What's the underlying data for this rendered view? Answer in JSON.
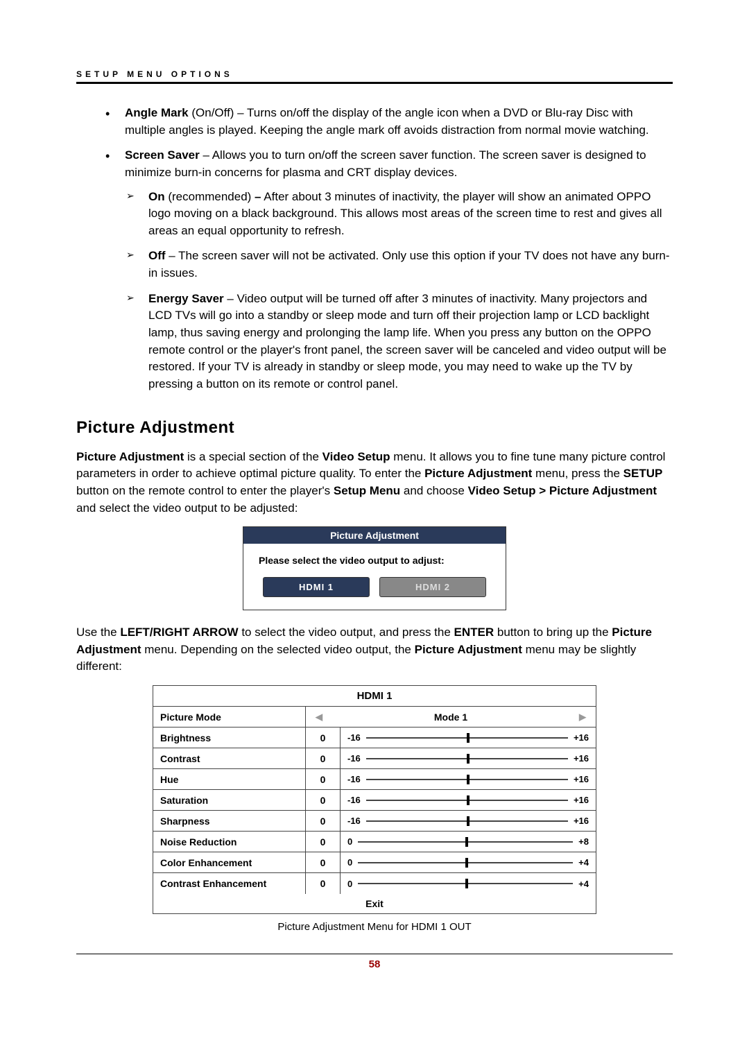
{
  "header": {
    "section": "SETUP MENU OPTIONS"
  },
  "list": {
    "item1": {
      "bold": "Angle Mark",
      "tail": " (On/Off) – Turns on/off the display of the angle icon when a DVD or Blu-ray Disc with multiple angles is played. Keeping the angle mark off avoids distraction from normal movie watching."
    },
    "item2": {
      "bold": "Screen Saver",
      "tail": " – Allows you to turn on/off the screen saver function. The screen saver is designed to minimize burn-in concerns for plasma and CRT display devices.",
      "sub1": {
        "bold": "On",
        "after_bold": " (recommended) ",
        "bold2": "–",
        "tail": " After about 3 minutes of inactivity, the player will show an animated OPPO logo moving on a black background. This allows most areas of the screen time to rest and gives all areas an equal opportunity to refresh."
      },
      "sub2": {
        "bold": "Off",
        "tail": " – The screen saver will not be activated. Only use this option if your TV does not have any burn-in issues."
      },
      "sub3": {
        "bold": "Energy Saver",
        "tail": " – Video output will be turned off after 3 minutes of inactivity. Many projectors and LCD TVs will go into a standby or sleep mode and turn off their projection lamp or LCD backlight lamp, thus saving energy and prolonging the lamp life.  When you press any button on the OPPO remote control or the player's front panel, the screen saver will be canceled and video output will be restored. If your TV is already in standby or sleep mode, you may need to wake up the TV by pressing a button on its remote or control panel."
      }
    }
  },
  "heading": "Picture Adjustment",
  "para1": {
    "p1a": "Picture Adjustment",
    "p1b": " is a special section of the ",
    "p1c": "Video Setup",
    "p1d": " menu. It allows you to fine tune many picture control parameters in order to achieve optimal picture quality. To enter the ",
    "p1e": "Picture Adjustment",
    "p1f": " menu, press the ",
    "p1g": "SETUP",
    "p1h": " button on the remote control to enter the player's ",
    "p1i": "Setup Menu",
    "p1j": " and choose ",
    "p1k": "Video Setup > Picture Adjustment",
    "p1l": " and select the video output to be adjusted:"
  },
  "dialog": {
    "title": "Picture Adjustment",
    "prompt": "Please select the video output to adjust:",
    "btn1": "HDMI  1",
    "btn2": "HDMI 2"
  },
  "para2": {
    "a": "Use the ",
    "b": "LEFT/RIGHT ARROW",
    "c": " to select the video output, and press the ",
    "d": "ENTER",
    "e": " button to bring up the ",
    "f": "Picture Adjustment",
    "g": " menu. Depending on the selected video output, the ",
    "h": "Picture Adjustment",
    "i": " menu may be slightly different:"
  },
  "table": {
    "title": "HDMI 1",
    "mode_label": "Picture Mode",
    "mode_value": "Mode 1",
    "rows": [
      {
        "label": "Brightness",
        "val": "0",
        "min": "-16",
        "max": "+16",
        "pos": 50
      },
      {
        "label": "Contrast",
        "val": "0",
        "min": "-16",
        "max": "+16",
        "pos": 50
      },
      {
        "label": "Hue",
        "val": "0",
        "min": "-16",
        "max": "+16",
        "pos": 50
      },
      {
        "label": "Saturation",
        "val": "0",
        "min": "-16",
        "max": "+16",
        "pos": 50
      },
      {
        "label": "Sharpness",
        "val": "0",
        "min": "-16",
        "max": "+16",
        "pos": 50
      },
      {
        "label": "Noise Reduction",
        "val": "0",
        "min": "0",
        "max": "+8",
        "pos": 50
      },
      {
        "label": "Color Enhancement",
        "val": "0",
        "min": "0",
        "max": "+4",
        "pos": 50
      },
      {
        "label": "Contrast Enhancement",
        "val": "0",
        "min": "0",
        "max": "+4",
        "pos": 50
      }
    ],
    "exit": "Exit"
  },
  "caption": "Picture Adjustment Menu for HDMI 1 OUT",
  "page": "58"
}
